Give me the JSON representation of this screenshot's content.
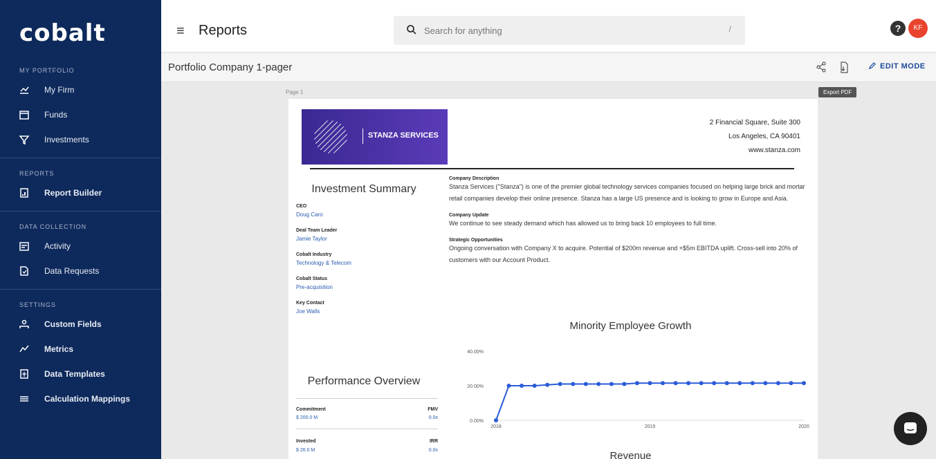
{
  "app": {
    "logo": "cobalt",
    "page_title": "Reports"
  },
  "sidebar": {
    "sections": [
      {
        "title": "MY PORTFOLIO",
        "items": [
          {
            "label": "My Firm",
            "icon": "chart-icon"
          },
          {
            "label": "Funds",
            "icon": "calendar-icon"
          },
          {
            "label": "Investments",
            "icon": "funnel-icon"
          }
        ]
      },
      {
        "title": "REPORTS",
        "items": [
          {
            "label": "Report Builder",
            "icon": "report-icon"
          }
        ]
      },
      {
        "title": "DATA COLLECTION",
        "items": [
          {
            "label": "Activity",
            "icon": "activity-icon"
          },
          {
            "label": "Data Requests",
            "icon": "request-icon"
          }
        ]
      },
      {
        "title": "SETTINGS",
        "items": [
          {
            "label": "Custom Fields",
            "icon": "fields-icon"
          },
          {
            "label": "Metrics",
            "icon": "metrics-icon"
          },
          {
            "label": "Data Templates",
            "icon": "template-icon"
          },
          {
            "label": "Calculation Mappings",
            "icon": "mapping-icon"
          }
        ]
      }
    ]
  },
  "search": {
    "placeholder": "Search for anything",
    "shortcut": "/"
  },
  "user": {
    "initials": "KF",
    "help": "?"
  },
  "subheader": {
    "title": "Portfolio Company 1-pager",
    "edit_mode": "EDIT MODE",
    "tooltip": "Export PDF"
  },
  "page_label": "Page 1",
  "doc": {
    "company_name": "STANZA SERVICES",
    "address": [
      "2 Financial Square, Suite 300",
      "Los Angeles, CA 90401",
      "www.stanza.com"
    ],
    "investment_summary_title": "Investment Summary",
    "fields": [
      {
        "label": "CEO",
        "value": "Doug Caro"
      },
      {
        "label": "Deal Team Leader",
        "value": "Jamie Taylor"
      },
      {
        "label": "Cobalt Industry",
        "value": "Technology & Telecom"
      },
      {
        "label": "Cobalt Status",
        "value": "Pre-acquisition"
      },
      {
        "label": "Key Contact",
        "value": "Joe Walls"
      }
    ],
    "sections": [
      {
        "label": "Company Description",
        "text": "Stanza Services (\"Stanza\") is one of the premier global technology services companies focused on helping large brick and mortar retail companies develop their online presence. Stanza has a large US presence and is looking to grow in Europe and Asia."
      },
      {
        "label": "Company Update",
        "text": "We continue to see steady demand which has allowed us to bring back 10 employees to full time."
      },
      {
        "label": "Strategic Opportunities",
        "text": "Ongoing conversation with Company X to acquire. Potential of $200m revenue and +$5m EBITDA uplift. Cross-sell into 20% of customers with our Account Product."
      }
    ],
    "performance_title": "Performance Overview",
    "performance": [
      {
        "l": "Commitment",
        "r": "FMV",
        "lv": "$ 200.0 M",
        "rv": "0.0x"
      },
      {
        "l": "Invested",
        "r": "IRR",
        "lv": "$ 26.0 M",
        "rv": "0.0x"
      }
    ],
    "revenue_title": "Revenue"
  },
  "chart_data": {
    "type": "line",
    "title": "Minority Employee Growth",
    "y_ticks": [
      "40.00%",
      "20.00%",
      "0.00%"
    ],
    "x_ticks": [
      "2018",
      "2019",
      "2020"
    ],
    "ylim": [
      0,
      40
    ],
    "series": [
      {
        "values": [
          0,
          20,
          20,
          20,
          20.5,
          21,
          21,
          21,
          21,
          21,
          21,
          21.5,
          21.5,
          21.5,
          21.5,
          21.5,
          21.5,
          21.5,
          21.5,
          21.5,
          21.5,
          21.5,
          21.5,
          21.5,
          21.5
        ]
      }
    ]
  }
}
